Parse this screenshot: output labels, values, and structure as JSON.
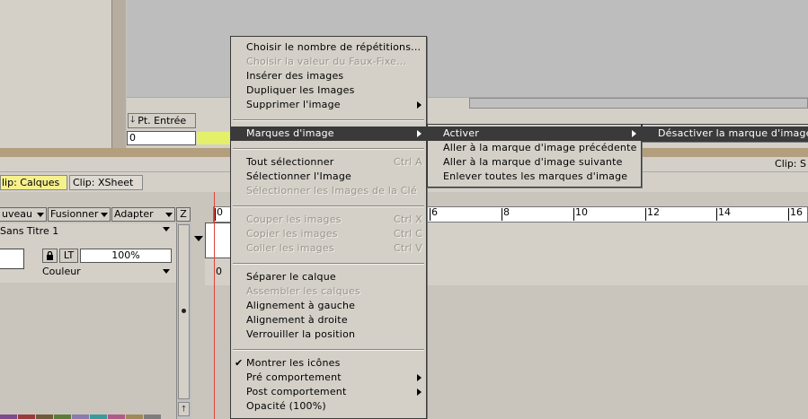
{
  "viewer": {
    "pt_entree_label": "Pt. Entrée",
    "pt_entree_value": "0"
  },
  "clip_bar": {
    "right_label": "Clip: S"
  },
  "tabs": [
    {
      "label": "lip: Calques",
      "active": true
    },
    {
      "label": "Clip: XSheet",
      "active": false
    }
  ],
  "layer_panel": {
    "dropdowns": [
      "uveau",
      "Fusionner",
      "Adapter"
    ],
    "z_label": "Z",
    "layer_name": "Sans Titre 1",
    "lt_label": "LT",
    "opacity_value": "100%",
    "mode_value": "Couleur"
  },
  "timeline": {
    "ruler_ticks": [
      "0",
      "6",
      "8",
      "10",
      "12",
      "14",
      "16"
    ],
    "track_zero": "0"
  },
  "context_menu": {
    "items": [
      {
        "label": "Choisir le nombre de répétitions...",
        "disabled": false
      },
      {
        "label": "Choisir la valeur du Faux-Fixe...",
        "disabled": true
      },
      {
        "label": "Insérer des images",
        "disabled": false
      },
      {
        "label": "Dupliquer les Images",
        "disabled": false
      },
      {
        "label": "Supprimer l'image",
        "disabled": false,
        "submenu": true
      },
      {
        "label": "Marques d'image",
        "disabled": false,
        "submenu": true,
        "highlighted": true
      },
      {
        "label": "Tout sélectionner",
        "disabled": false,
        "shortcut": "Ctrl A"
      },
      {
        "label": "Sélectionner l'Image",
        "disabled": false
      },
      {
        "label": "Sélectionner les Images de la Clé",
        "disabled": true
      },
      {
        "label": "Couper les images",
        "disabled": true,
        "shortcut": "Ctrl X"
      },
      {
        "label": "Copier les images",
        "disabled": true,
        "shortcut": "Ctrl C"
      },
      {
        "label": "Coller les images",
        "disabled": true,
        "shortcut": "Ctrl V"
      },
      {
        "label": "Séparer le calque",
        "disabled": false
      },
      {
        "label": "Assembler les calques",
        "disabled": true
      },
      {
        "label": "Alignement à gauche",
        "disabled": false
      },
      {
        "label": "Alignement à droite",
        "disabled": false
      },
      {
        "label": "Verrouiller la position",
        "disabled": false
      },
      {
        "label": "Montrer les icônes",
        "disabled": false,
        "checked": true
      },
      {
        "label": "Pré comportement",
        "disabled": false,
        "submenu": true
      },
      {
        "label": "Post comportement",
        "disabled": false,
        "submenu": true
      },
      {
        "label": "Opacité (100%)",
        "disabled": false
      }
    ]
  },
  "submenu_marques": {
    "items": [
      {
        "label": "Activer",
        "submenu": true,
        "highlighted": true
      },
      {
        "label": "Aller à la marque d'image précédente"
      },
      {
        "label": "Aller à la marque d'image suivante"
      },
      {
        "label": "Enlever toutes les marques d'image"
      }
    ]
  },
  "submenu_activer": {
    "items": [
      {
        "label": "Désactiver la marque d'image"
      }
    ]
  },
  "colors": {
    "accent_yellow": "#f6f08d",
    "highlight": "#3a3a3a",
    "divider": "#b39e7e",
    "playhead": "#e0443c"
  }
}
